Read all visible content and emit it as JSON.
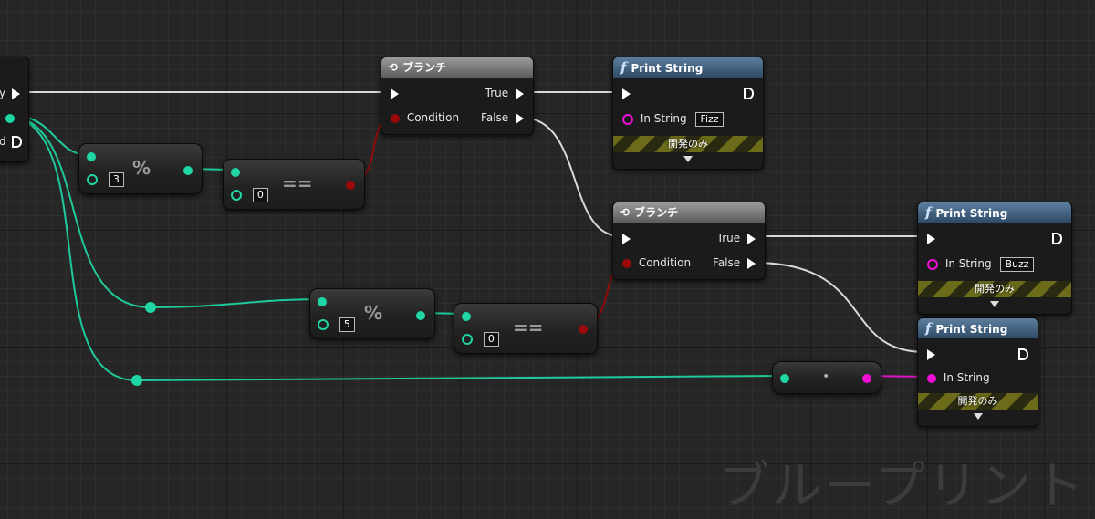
{
  "watermark": "ブループリント",
  "left_node": {
    "exec_label_fragment": "y",
    "int_out_label_fragment": "d"
  },
  "branch_node_1": {
    "title": "ブランチ",
    "true_label": "True",
    "false_label": "False",
    "condition_label": "Condition"
  },
  "branch_node_2": {
    "title": "ブランチ",
    "true_label": "True",
    "false_label": "False",
    "condition_label": "Condition"
  },
  "modulo_1": {
    "operator": "%",
    "divisor": "3"
  },
  "modulo_2": {
    "operator": "%",
    "divisor": "5"
  },
  "equal_1": {
    "operator": "==",
    "compare_value": "0"
  },
  "equal_2": {
    "operator": "==",
    "compare_value": "0"
  },
  "conversion_node": {
    "symbol": "•"
  },
  "print_1": {
    "title": "Print String",
    "in_string_label": "In String",
    "in_string_value": "Fizz",
    "dev_only_label": "開発のみ"
  },
  "print_2": {
    "title": "Print String",
    "in_string_label": "In String",
    "in_string_value": "Buzz",
    "dev_only_label": "開発のみ"
  },
  "print_3": {
    "title": "Print String",
    "in_string_label": "In String",
    "dev_only_label": "開発のみ"
  },
  "colors": {
    "exec": "#ffffff",
    "integer": "#1fd6a5",
    "boolean": "#9b0a0a",
    "string": "#f20fd6",
    "func_header": "#3f607f",
    "branch_header": "#7a7a7a"
  }
}
